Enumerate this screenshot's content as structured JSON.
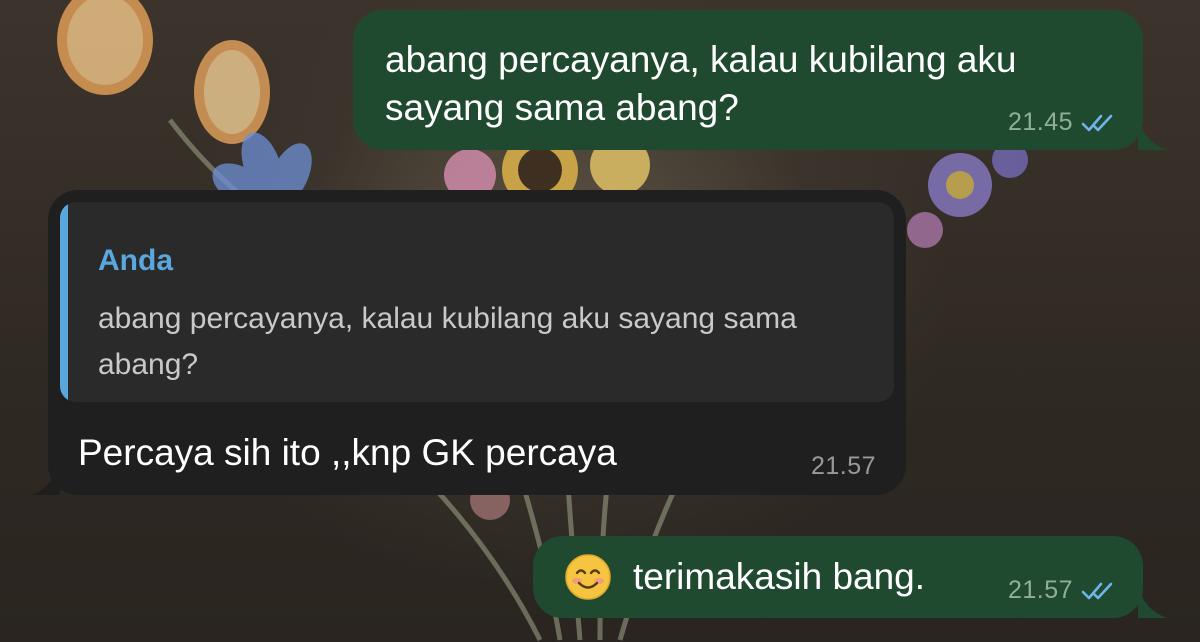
{
  "messages": [
    {
      "direction": "outgoing",
      "text": "abang percayanya, kalau kubilang aku sayang sama abang?",
      "time": "21.45",
      "status": "read-double-check-icon"
    },
    {
      "direction": "incoming",
      "reply_to": {
        "author": "Anda",
        "text": "abang percayanya, kalau kubilang aku sayang sama abang?"
      },
      "text": "Percaya sih ito ,,knp GK percaya",
      "time": "21.57"
    },
    {
      "direction": "outgoing",
      "emoji": "smiling-face-icon",
      "text": "terimakasih bang.",
      "time": "21.57",
      "status": "read-double-check-icon"
    }
  ],
  "colors": {
    "outgoing_bubble": "#1f4a30",
    "incoming_bubble": "#1f1f1f",
    "reply_accent": "#5aa7dd",
    "read_ticks": "#6fb6e8"
  }
}
